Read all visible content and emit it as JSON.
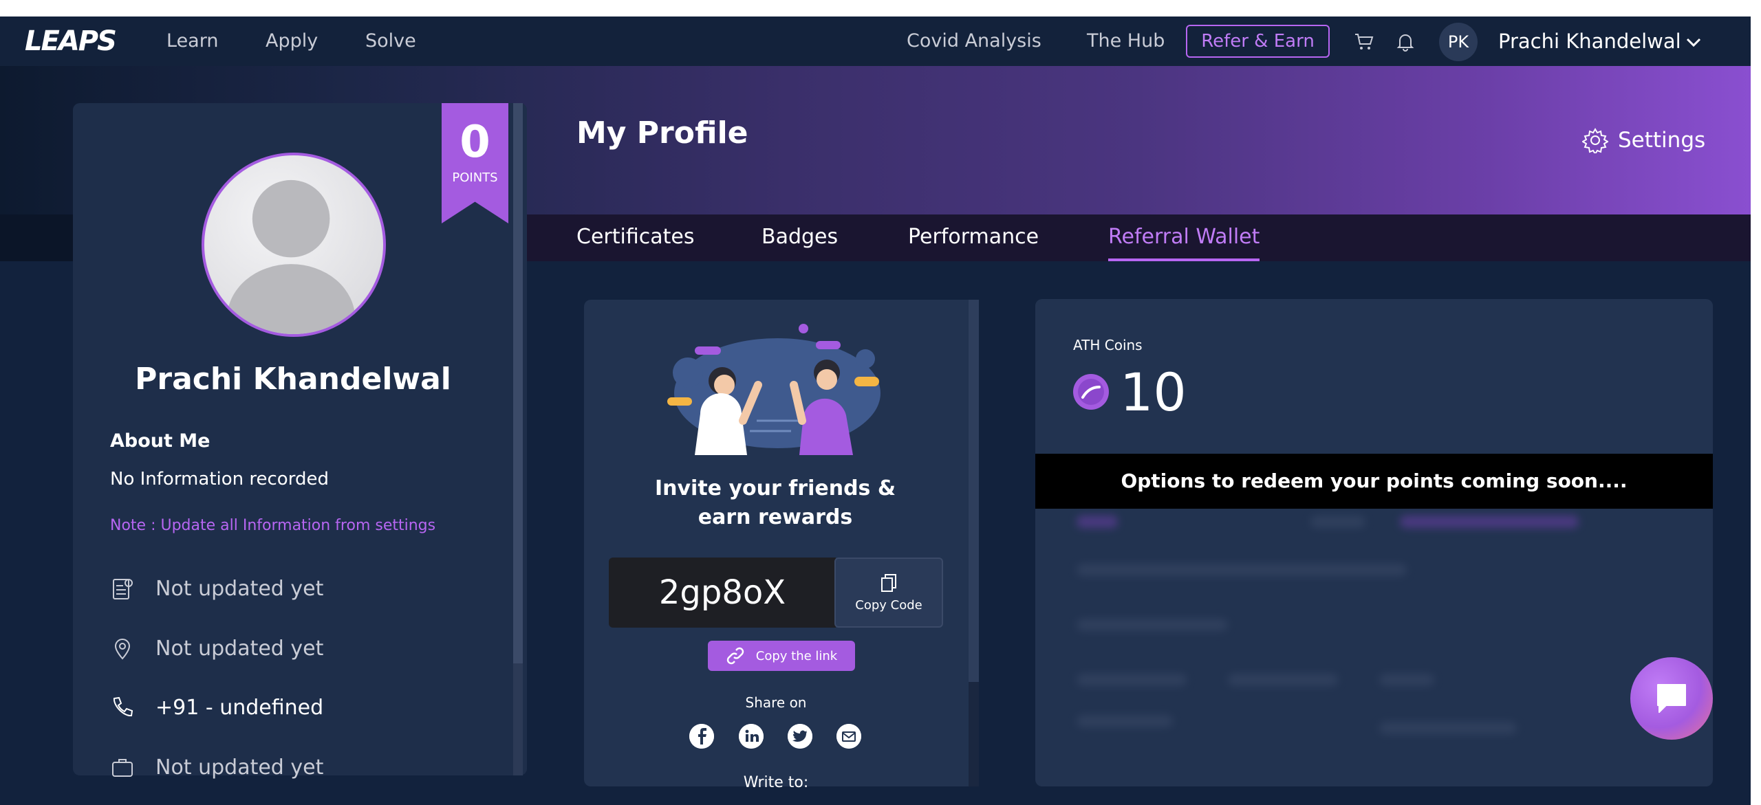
{
  "nav": {
    "logo": "LEAPS",
    "links": [
      "Learn",
      "Apply",
      "Solve"
    ],
    "right_links": [
      "Covid Analysis",
      "The Hub"
    ],
    "refer_button": "Refer & Earn",
    "avatar_initials": "PK",
    "user_name": "Prachi Khandelwal"
  },
  "header": {
    "title": "My Profile",
    "settings_label": "Settings",
    "tabs": [
      {
        "label": "Certificates",
        "active": false
      },
      {
        "label": "Badges",
        "active": false
      },
      {
        "label": "Performance",
        "active": false
      },
      {
        "label": "Referral Wallet",
        "active": true
      }
    ]
  },
  "profile": {
    "points_value": "0",
    "points_label": "POINTS",
    "name": "Prachi Khandelwal",
    "about_title": "About Me",
    "about_text": "No Information recorded",
    "note": "Note : Update all Information from settings",
    "info": [
      {
        "icon": "id-card-icon",
        "text": "Not updated yet"
      },
      {
        "icon": "location-pin-icon",
        "text": "Not updated yet"
      },
      {
        "icon": "phone-icon",
        "text": "+91 - undefined"
      },
      {
        "icon": "briefcase-icon",
        "text": "Not updated yet"
      }
    ]
  },
  "referral": {
    "invite_line1": "Invite your friends &",
    "invite_line2": "earn rewards",
    "code": "2gp8oX",
    "copy_code_label": "Copy Code",
    "copy_link_label": "Copy the link",
    "share_on": "Share on",
    "social": [
      "facebook-icon",
      "linkedin-icon",
      "twitter-icon",
      "email-icon"
    ],
    "write_to": "Write to:"
  },
  "coins": {
    "label": "ATH Coins",
    "value": "10",
    "banner": "Options to redeem your points coming soon...."
  },
  "colors": {
    "accent": "#a45be0",
    "accent_light": "#c07cf6",
    "page_bg": "#12223d",
    "card_bg": "#223350"
  }
}
